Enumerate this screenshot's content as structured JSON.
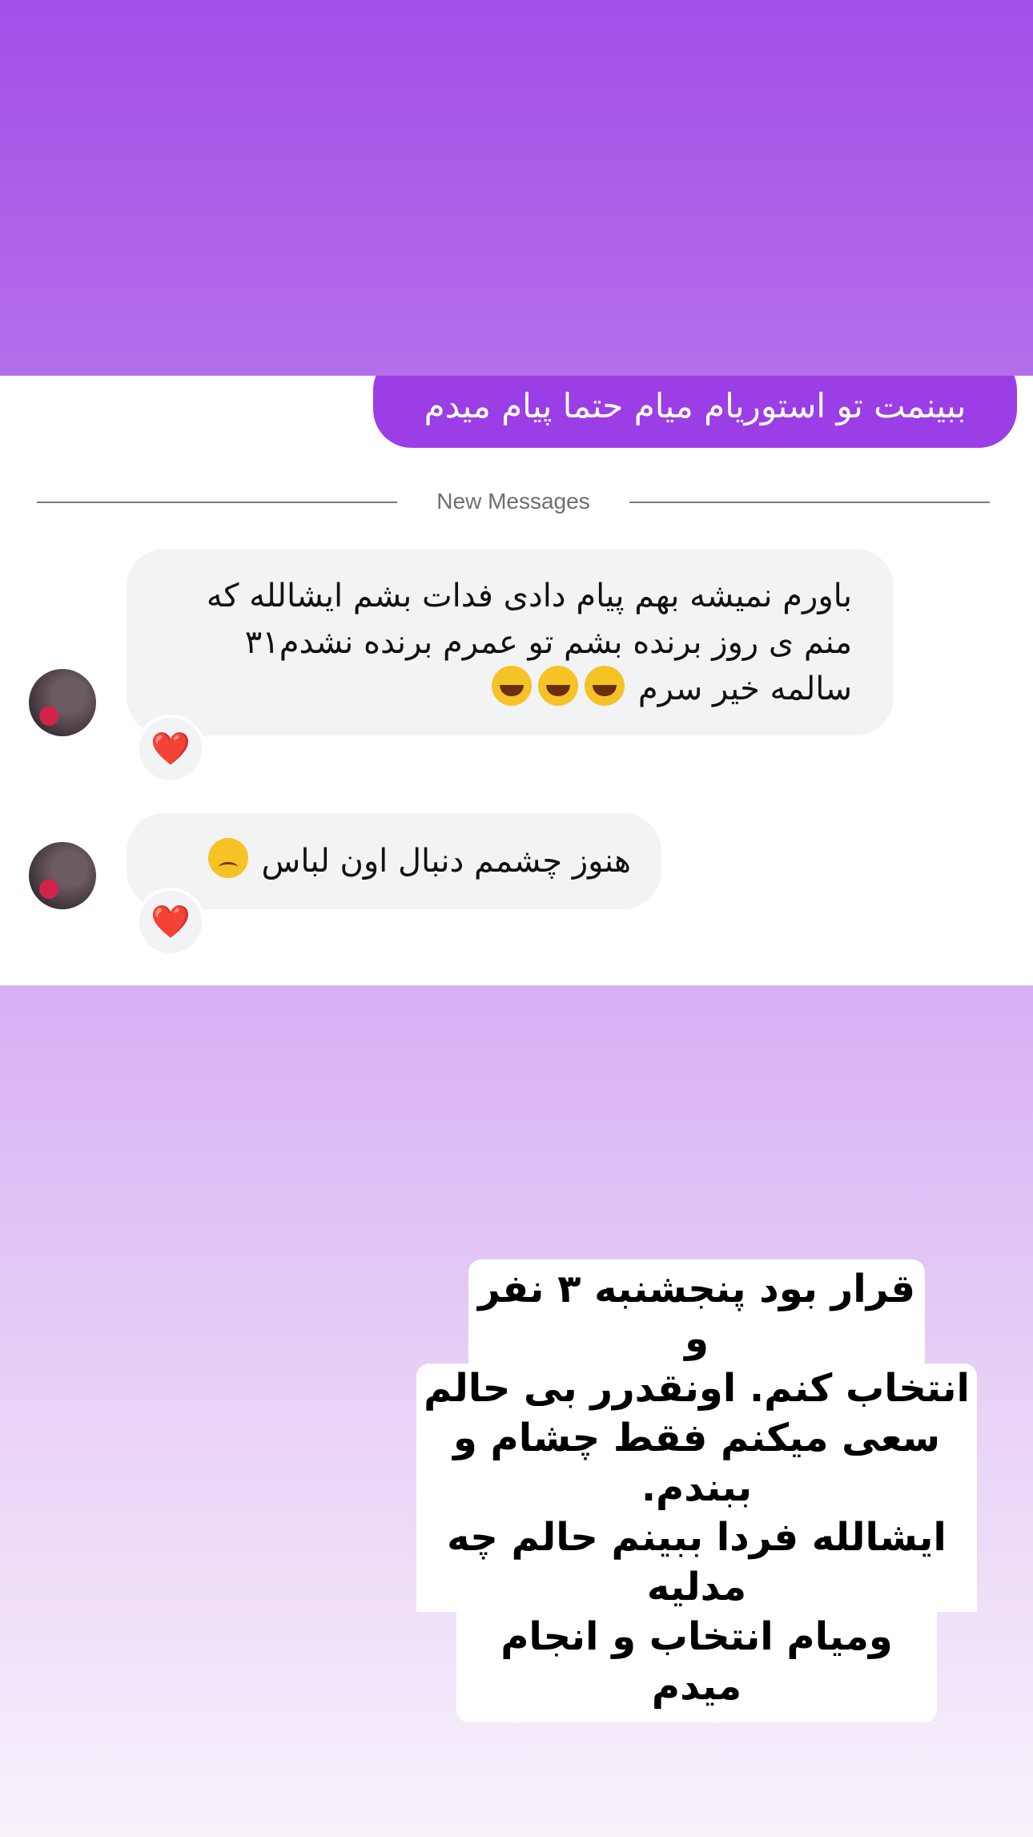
{
  "colors": {
    "top_background": "#a44ee8",
    "sent_bubble": "#9b3ee6",
    "received_bubble": "#f2f3f5",
    "reaction_heart": "#e6192b"
  },
  "sent_message": {
    "text": "ببینمت تو استوریام میام حتما پیام میدم"
  },
  "divider": {
    "label": "New Messages"
  },
  "received_messages": [
    {
      "text": "باورم نمیشه بهم پیام دادی فدات بشم ایشالله که منم ی روز برنده بشم تو عمرم برنده نشدم۳۱ سالمه خیر سرم",
      "emoji": "rolling-on-floor-laughing-emoji",
      "reaction": "❤️"
    },
    {
      "text": "هنوز چشمم دنبال اون لباس",
      "emoji": "frowning-face-emoji",
      "reaction": "❤️"
    }
  ],
  "story_caption": {
    "lines": [
      "قرار بود پنجشنبه ۳ نفر و",
      "انتخاب کنم. اونقدرر بی حالم",
      "سعی میکنم فقط چشام و ببندم.",
      "ایشالله فردا ببینم حالم چه مدلیه",
      "ومیام انتخاب و انجام میدم"
    ]
  }
}
